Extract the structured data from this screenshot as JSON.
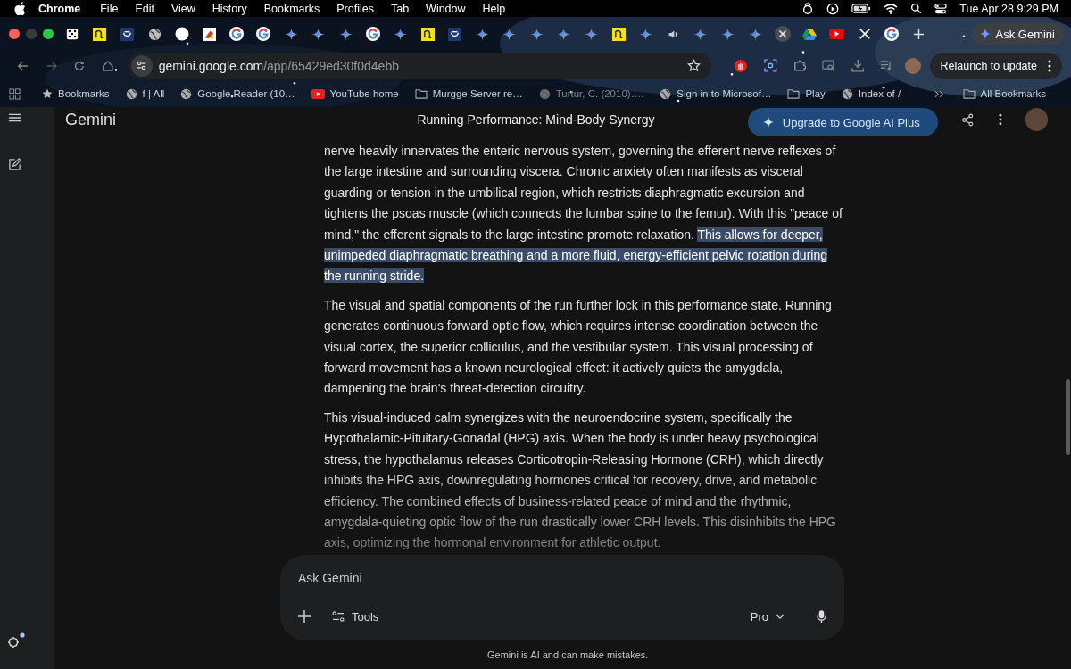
{
  "menu_bar": {
    "app": "Chrome",
    "items": [
      "File",
      "Edit",
      "View",
      "History",
      "Bookmarks",
      "Profiles",
      "Tab",
      "Window",
      "Help"
    ],
    "clock": "Tue Apr 28  9:29 PM"
  },
  "tabs": [
    {
      "kind": "dice"
    },
    {
      "kind": "yellow"
    },
    {
      "kind": "blue"
    },
    {
      "kind": "globe"
    },
    {
      "kind": "circle"
    },
    {
      "kind": "red"
    },
    {
      "kind": "google"
    },
    {
      "kind": "google"
    },
    {
      "kind": "gemini"
    },
    {
      "kind": "gemini"
    },
    {
      "kind": "gemini"
    },
    {
      "kind": "google"
    },
    {
      "kind": "gemini"
    },
    {
      "kind": "yellow"
    },
    {
      "kind": "blue"
    },
    {
      "kind": "gemini"
    },
    {
      "kind": "gemini"
    },
    {
      "kind": "gemini"
    },
    {
      "kind": "gemini"
    },
    {
      "kind": "gemini"
    },
    {
      "kind": "yellow"
    },
    {
      "kind": "gemini"
    },
    {
      "kind": "speaker"
    },
    {
      "kind": "gemini"
    },
    {
      "kind": "gemini"
    },
    {
      "kind": "gemini"
    },
    {
      "kind": "close"
    },
    {
      "kind": "drive"
    },
    {
      "kind": "youtube"
    },
    {
      "kind": "x"
    },
    {
      "kind": "google"
    }
  ],
  "ask_gemini_button": "Ask Gemini",
  "address_bar": {
    "domain": "gemini.google.com",
    "path": "/app/65429ed30f0d4ebb"
  },
  "relaunch_button": "Relaunch to update",
  "bookmarks": [
    {
      "label": "Bookmarks",
      "kind": "star"
    },
    {
      "label": "f | All",
      "kind": "globe"
    },
    {
      "label": "Google Reader (10…",
      "kind": "globe"
    },
    {
      "label": "YouTube home",
      "kind": "youtube"
    },
    {
      "label": "Murgge Server re…",
      "kind": "folder"
    },
    {
      "label": "Turtur, C. (2010)….",
      "kind": "faded"
    },
    {
      "label": "Sign in to Microsof…",
      "kind": "globe"
    },
    {
      "label": "Play",
      "kind": "folder"
    },
    {
      "label": "Index of /",
      "kind": "globe"
    }
  ],
  "all_bookmarks": "All Bookmarks",
  "app": {
    "name": "Gemini",
    "chat_title": "Running Performance: Mind-Body Synergy",
    "upgrade_button": "Upgrade to Google AI Plus"
  },
  "paragraphs": [
    {
      "text": "nerve heavily innervates the enteric nervous system, governing the efferent nerve reflexes of the large intestine and surrounding viscera. Chronic anxiety often manifests as visceral guarding or tension in the umbilical region, which restricts diaphragmatic excursion and tightens the psoas muscle (which connects the lumbar spine to the femur). With this \"peace of mind,\" the efferent signals to the large intestine promote relaxation. ",
      "highlight": "This allows for deeper, unimpeded diaphragmatic breathing and a more fluid, energy-efficient pelvic rotation during the running stride."
    },
    {
      "text": "The visual and spatial components of the run further lock in this performance state. Running generates continuous forward optic flow, which requires intense coordination between the visual cortex, the superior colliculus, and the vestibular system. This visual processing of forward movement has a known neurological effect: it actively quiets the amygdala, dampening the brain's threat-detection circuitry."
    },
    {
      "text": "This visual-induced calm synergizes with the neuroendocrine system, specifically the Hypothalamic-Pituitary-Gonadal (HPG) axis. When the body is under heavy psychological stress, the hypothalamus releases Corticotropin-Releasing Hormone (CRH), which directly inhibits the HPG axis, downregulating hormones critical for recovery, drive, and metabolic efficiency. The combined effects of business-related peace of mind and the rhythmic, amygdala-quieting optic flow of the run drastically lower CRH levels. This disinhibits the HPG axis, optimizing the hormonal environment for athletic output."
    }
  ],
  "prompt": {
    "placeholder": "Ask Gemini",
    "tools": "Tools",
    "model": "Pro"
  },
  "disclaimer": "Gemini is AI and can make mistakes."
}
